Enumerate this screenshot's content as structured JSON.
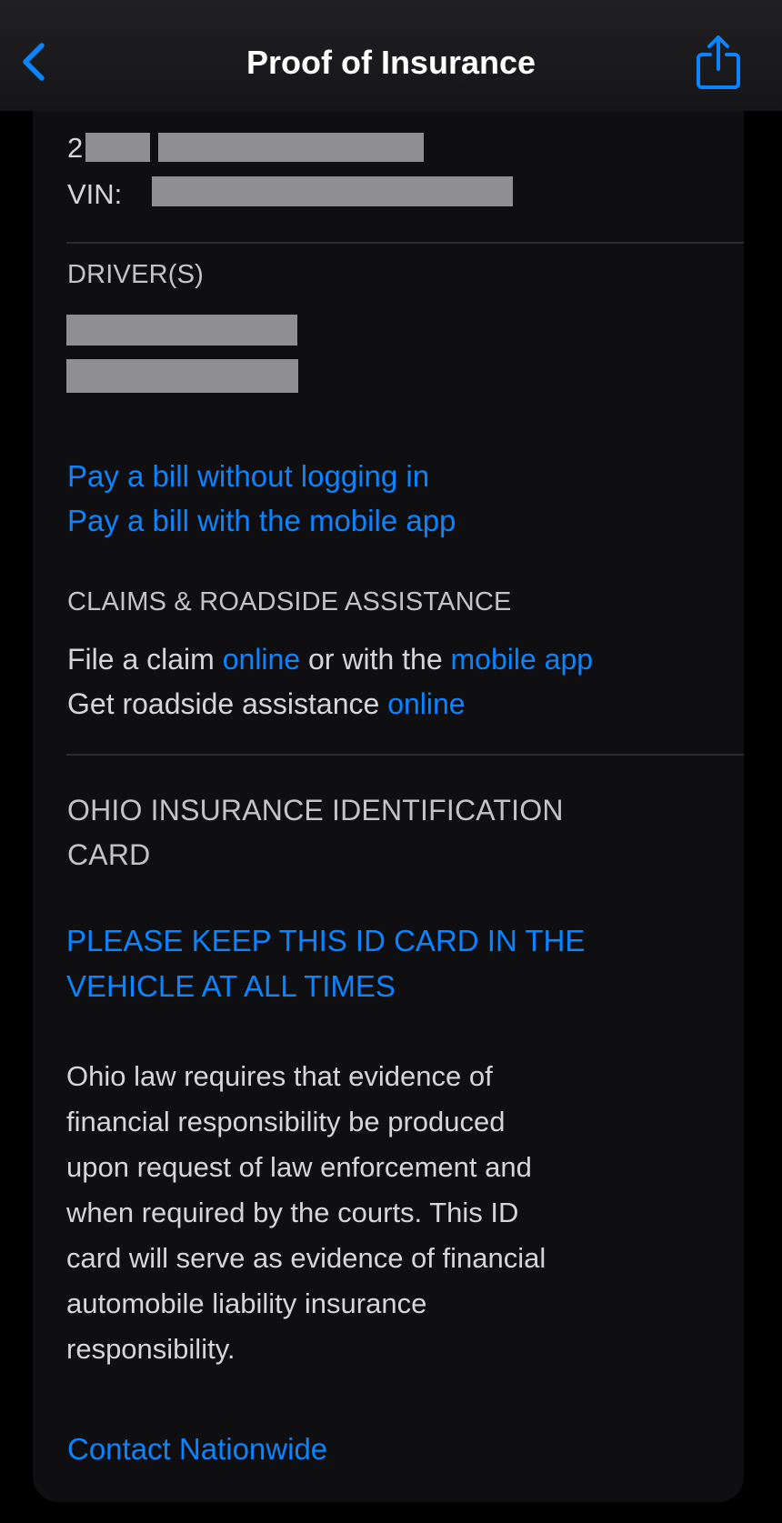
{
  "header": {
    "title": "Proof of Insurance"
  },
  "vehicle": {
    "year_prefix": "2",
    "vin_label": "VIN:"
  },
  "drivers": {
    "heading": "DRIVER(S)"
  },
  "billing": {
    "pay_without_login": "Pay a bill without logging in",
    "pay_with_app": "Pay a bill with the mobile app"
  },
  "claims": {
    "heading": "CLAIMS & ROADSIDE ASSISTANCE",
    "file_claim_prefix": "File a claim",
    "file_claim_online": "online",
    "file_claim_middle": "or with the",
    "file_claim_app": "mobile app",
    "roadside_prefix": "Get roadside assistance",
    "roadside_online": "online"
  },
  "id_card": {
    "heading_line1": "OHIO INSURANCE IDENTIFICATION",
    "heading_line2": "CARD",
    "keep_notice_line1": "PLEASE KEEP THIS ID CARD IN THE",
    "keep_notice_line2": "VEHICLE AT ALL TIMES",
    "law_text": [
      "Ohio law requires that evidence of",
      "financial responsibility be produced",
      "upon request of law enforcement and",
      "when required by the courts. This ID",
      "card will serve as evidence of financial",
      "automobile liability insurance",
      "responsibility."
    ]
  },
  "contact": {
    "link": "Contact Nationwide"
  },
  "colors": {
    "accent": "#0a84ff",
    "background": "#000000",
    "card": "#0f0f11",
    "redaction": "#8e8e93"
  },
  "icons": {
    "back": "chevron-left",
    "share": "share-up-arrow"
  }
}
